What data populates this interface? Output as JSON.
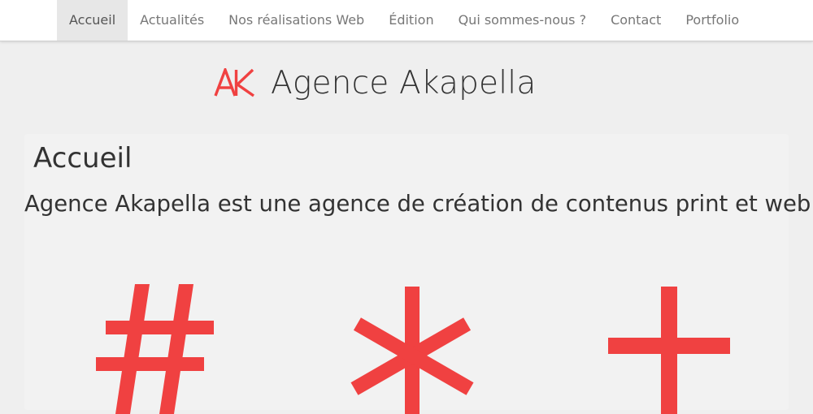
{
  "nav": {
    "items": [
      {
        "label": "Accueil",
        "active": true
      },
      {
        "label": "Actualités",
        "active": false
      },
      {
        "label": "Nos réalisations Web",
        "active": false
      },
      {
        "label": "Édition",
        "active": false
      },
      {
        "label": "Qui sommes-nous ?",
        "active": false
      },
      {
        "label": "Contact",
        "active": false
      },
      {
        "label": "Portfolio",
        "active": false
      }
    ]
  },
  "brand": {
    "logo_text": "AK",
    "name": "Agence Akapella"
  },
  "main": {
    "title": "Accueil",
    "tagline": "Agence Akapella est une agence de création de contenus print et web",
    "symbols": [
      {
        "name": "hash-icon",
        "glyph": "#"
      },
      {
        "name": "asterisk-icon",
        "glyph": "*"
      },
      {
        "name": "plus-icon",
        "glyph": "+"
      }
    ]
  },
  "colors": {
    "accent": "#f04141",
    "text": "#333333",
    "nav_text": "#777777",
    "nav_active_bg": "#e7e7e7",
    "page_bg": "#efefef"
  }
}
